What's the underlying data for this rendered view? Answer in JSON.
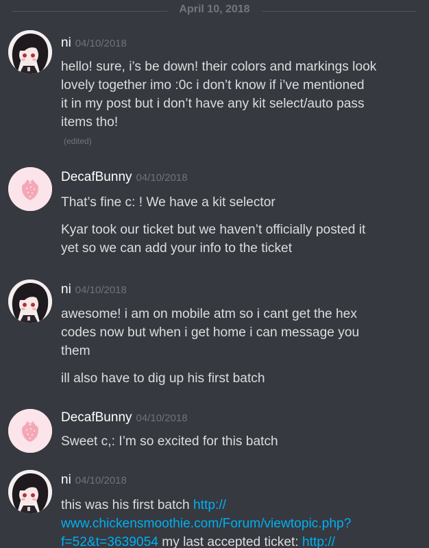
{
  "divider": {
    "date": "April 10, 2018"
  },
  "messages": [
    {
      "username": "ni",
      "timestamp": "04/10/2018",
      "avatar_icon": "anime-girl-avatar-icon",
      "lines": [
        "hello! sure, i’s be down! their colors and markings look",
        "lovely together imo :0c i don’t know if i’ve mentioned",
        "it in my post but i don’t have any kit select/auto pass",
        "items tho!"
      ],
      "edited_label": "(edited)"
    },
    {
      "username": "DecafBunny",
      "timestamp": "04/10/2018",
      "avatar_icon": "strawberry-avatar-icon",
      "line1": "That’s fine c: ! We have a kit selector",
      "line2a": "Kyar took our ticket but we haven’t officially posted it",
      "line2b": "yet so we can add your info to the ticket"
    },
    {
      "username": "ni",
      "timestamp": "04/10/2018",
      "avatar_icon": "anime-girl-avatar-icon",
      "lines": [
        "awesome! i am on mobile atm so i cant get the hex",
        "codes now but when i get home i can message you",
        "them"
      ],
      "line2": "ill also have to dig up his first batch"
    },
    {
      "username": "DecafBunny",
      "timestamp": "04/10/2018",
      "avatar_icon": "strawberry-avatar-icon",
      "line1": "Sweet c,: I’m so excited for this batch"
    },
    {
      "username": "ni",
      "timestamp": "04/10/2018",
      "avatar_icon": "anime-girl-avatar-icon",
      "text_prefix": "this was his first batch ",
      "link1_a": "http://",
      "link1_b": "www.chickensmoothie.com/Forum/viewtopic.php?",
      "link1_c": "f=52&t=3639054",
      "text_mid": " my last accepted ticket: ",
      "link2": "http://"
    }
  ]
}
